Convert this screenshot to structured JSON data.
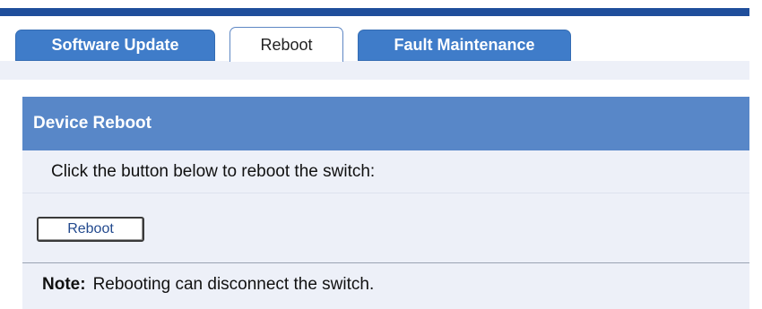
{
  "tabs": [
    {
      "label": "Software Update",
      "active": false
    },
    {
      "label": "Reboot",
      "active": true
    },
    {
      "label": "Fault Maintenance",
      "active": false
    }
  ],
  "panel": {
    "title": "Device Reboot",
    "description": "Click the button below to reboot the switch:",
    "button_label": "Reboot",
    "note_label": "Note:",
    "note_text": "Rebooting can disconnect the switch."
  },
  "colors": {
    "top_bar": "#1f4e9b",
    "tab_inactive": "#3f7cc9",
    "panel_header": "#5887c8",
    "panel_background": "#edf0f8"
  }
}
